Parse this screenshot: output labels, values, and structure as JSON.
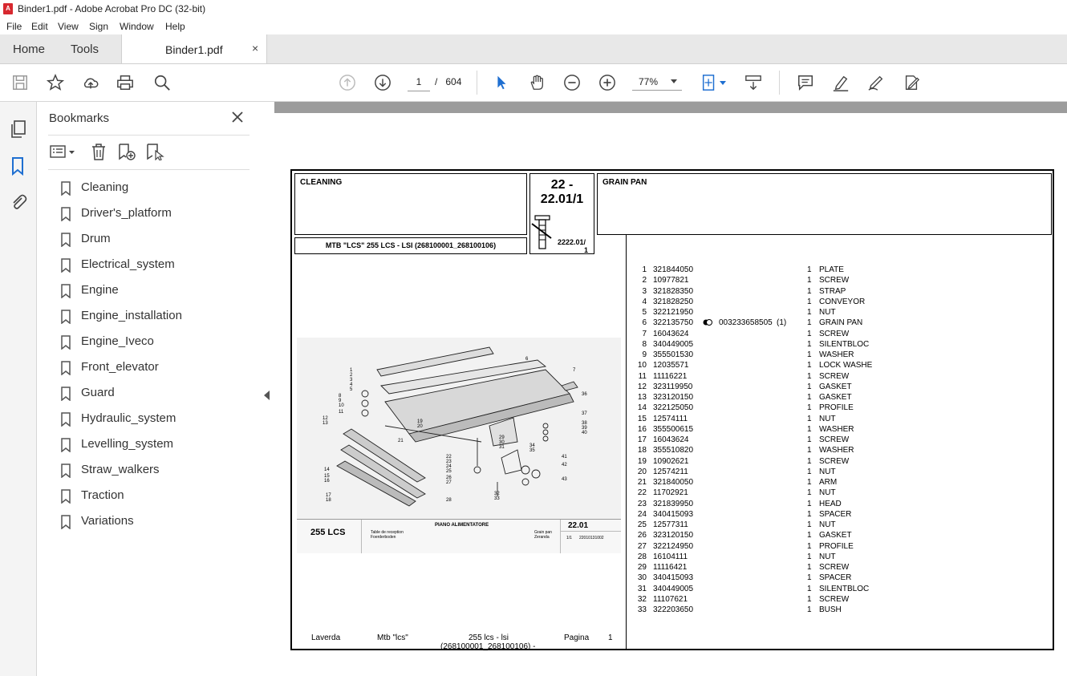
{
  "window": {
    "title": "Binder1.pdf - Adobe Acrobat Pro DC (32-bit)",
    "app_icon": "pdf-icon"
  },
  "menu": [
    "File",
    "Edit",
    "View",
    "Sign",
    "Window",
    "Help"
  ],
  "tabs": {
    "home": "Home",
    "tools": "Tools",
    "document": "Binder1.pdf",
    "close": "×"
  },
  "toolbar": {
    "page_current": "1",
    "page_sep": "/",
    "page_total": "604",
    "zoom": "77%"
  },
  "bookmarks": {
    "title": "Bookmarks",
    "items": [
      "Cleaning",
      "Driver's_platform",
      "Drum",
      "Electrical_system",
      "Engine",
      "Engine_installation",
      "Engine_Iveco",
      "Front_elevator",
      "Guard",
      "Hydraulic_system",
      "Levelling_system",
      "Straw_walkers",
      "Traction",
      "Variations"
    ]
  },
  "pdf": {
    "section": "CLEANING",
    "code_top": "22 -",
    "code_bottom": "22.01/1",
    "ref": "2222.01/",
    "ref2": "1",
    "group": "GRAIN PAN",
    "model": "MTB \"LCS\" 255 LCS - LSI (268100001_268100106)",
    "diagram_model": "255 LCS",
    "diagram_title": "PIANO ALIMENTATORE",
    "diagram_code": "22.01",
    "diagram_sub_left1": "Table de reception",
    "diagram_sub_left2": "Foerderboden",
    "diagram_sub_right1": "Grain pan",
    "diagram_sub_right2": "Zeranda",
    "diagram_page": "1/1",
    "diagram_num": "22010131002",
    "footer": {
      "brand": "Laverda",
      "mtb": "Mtb \"lcs\"",
      "model": "255 lcs - lsi",
      "range": "(268100001_268100106) -",
      "pagina": "Pagina",
      "page": "1"
    },
    "parts": [
      {
        "n": "1",
        "code": "321844050",
        "q": "1",
        "desc": "PLATE"
      },
      {
        "n": "2",
        "code": "10977821",
        "q": "1",
        "desc": "SCREW"
      },
      {
        "n": "3",
        "code": "321828350",
        "q": "1",
        "desc": "STRAP"
      },
      {
        "n": "4",
        "code": "321828250",
        "q": "1",
        "desc": "CONVEYOR"
      },
      {
        "n": "5",
        "code": "322121950",
        "q": "1",
        "desc": "NUT"
      },
      {
        "n": "6",
        "code": "322135750",
        "q": "1",
        "desc": "GRAIN PAN",
        "alt": "003233658505",
        "alt_q": "(1)"
      },
      {
        "n": "7",
        "code": "16043624",
        "q": "1",
        "desc": "SCREW"
      },
      {
        "n": "8",
        "code": "340449005",
        "q": "1",
        "desc": "SILENTBLOC"
      },
      {
        "n": "9",
        "code": "355501530",
        "q": "1",
        "desc": "WASHER"
      },
      {
        "n": "10",
        "code": "12035571",
        "q": "1",
        "desc": "LOCK WASHE"
      },
      {
        "n": "11",
        "code": "11116221",
        "q": "1",
        "desc": "SCREW"
      },
      {
        "n": "12",
        "code": "323119950",
        "q": "1",
        "desc": "GASKET"
      },
      {
        "n": "13",
        "code": "323120150",
        "q": "1",
        "desc": "GASKET"
      },
      {
        "n": "14",
        "code": "322125050",
        "q": "1",
        "desc": "PROFILE"
      },
      {
        "n": "15",
        "code": "12574111",
        "q": "1",
        "desc": "NUT"
      },
      {
        "n": "16",
        "code": "355500615",
        "q": "1",
        "desc": "WASHER"
      },
      {
        "n": "17",
        "code": "16043624",
        "q": "1",
        "desc": "SCREW"
      },
      {
        "n": "18",
        "code": "355510820",
        "q": "1",
        "desc": "WASHER"
      },
      {
        "n": "19",
        "code": "10902621",
        "q": "1",
        "desc": "SCREW"
      },
      {
        "n": "20",
        "code": "12574211",
        "q": "1",
        "desc": "NUT"
      },
      {
        "n": "21",
        "code": "321840050",
        "q": "1",
        "desc": "ARM"
      },
      {
        "n": "22",
        "code": "11702921",
        "q": "1",
        "desc": "NUT"
      },
      {
        "n": "23",
        "code": "321839950",
        "q": "1",
        "desc": "HEAD"
      },
      {
        "n": "24",
        "code": "340415093",
        "q": "1",
        "desc": "SPACER"
      },
      {
        "n": "25",
        "code": "12577311",
        "q": "1",
        "desc": "NUT"
      },
      {
        "n": "26",
        "code": "323120150",
        "q": "1",
        "desc": "GASKET"
      },
      {
        "n": "27",
        "code": "322124950",
        "q": "1",
        "desc": "PROFILE"
      },
      {
        "n": "28",
        "code": "16104111",
        "q": "1",
        "desc": "NUT"
      },
      {
        "n": "29",
        "code": "11116421",
        "q": "1",
        "desc": "SCREW"
      },
      {
        "n": "30",
        "code": "340415093",
        "q": "1",
        "desc": "SPACER"
      },
      {
        "n": "31",
        "code": "340449005",
        "q": "1",
        "desc": "SILENTBLOC"
      },
      {
        "n": "32",
        "code": "11107621",
        "q": "1",
        "desc": "SCREW"
      },
      {
        "n": "33",
        "code": "322203650",
        "q": "1",
        "desc": "BUSH"
      }
    ]
  }
}
